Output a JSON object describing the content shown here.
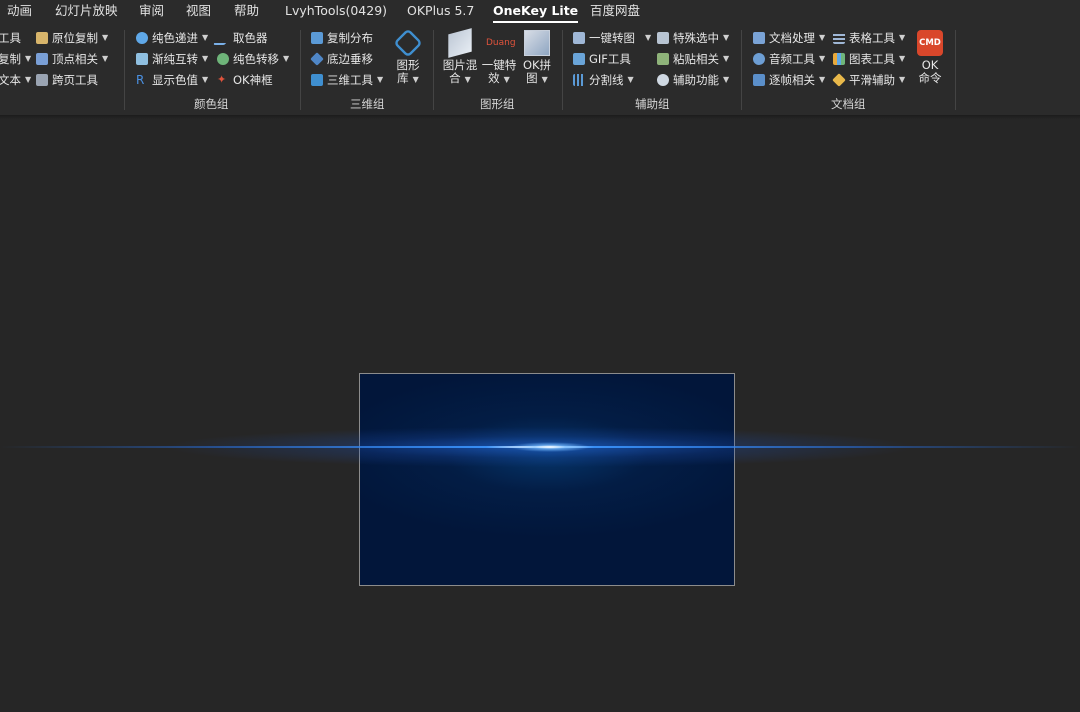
{
  "tabs": [
    {
      "label": "动画"
    },
    {
      "label": "幻灯片放映"
    },
    {
      "label": "审阅"
    },
    {
      "label": "视图"
    },
    {
      "label": "帮助"
    },
    {
      "label": "LvyhTools(0429)"
    },
    {
      "label": "OKPlus 5.7"
    },
    {
      "label": "OneKey Lite",
      "active": true
    },
    {
      "label": "百度网盘"
    }
  ],
  "ribbon": {
    "col0": [
      "工具",
      "复制",
      "文本"
    ],
    "col1": [
      "原位复制",
      "顶点相关",
      "跨页工具"
    ],
    "color_group": {
      "items_a": [
        "纯色递进",
        "渐纯互转",
        "显示色值"
      ],
      "items_b": [
        "取色器",
        "纯色转移",
        "OK神框"
      ],
      "label": "颜色组"
    },
    "threed_group": {
      "items": [
        "复制分布",
        "底边垂移",
        "三维工具"
      ],
      "big": "图形库",
      "big_line1": "图形",
      "big_line2": "库",
      "label": "三维组"
    },
    "shape_group": {
      "big1_line1": "图片混",
      "big1_line2": "合",
      "big2_line1": "一键特",
      "big2_line2": "效",
      "big2_badge": "Duang",
      "big3_line1": "OK拼",
      "big3_line2": "图",
      "label": "图形组"
    },
    "assist_group": {
      "items_a": [
        "一键转图",
        "GIF工具",
        "分割线"
      ],
      "items_b": [
        "特殊选中",
        "粘贴相关",
        "辅助功能"
      ],
      "label": "辅助组"
    },
    "doc_group": {
      "items_a": [
        "文档处理",
        "音频工具",
        "逐帧相关"
      ],
      "items_b": [
        "表格工具",
        "图表工具",
        "平滑辅助"
      ],
      "cmd_badge": "CMD",
      "cmd_line1": "OK",
      "cmd_line2": "命令",
      "label": "文档组"
    }
  },
  "colors": {
    "background": "#262626",
    "ribbon": "#2b2b2b",
    "slide": "#031d45",
    "beam": "#3c96ff",
    "cmd": "#d9472b"
  }
}
